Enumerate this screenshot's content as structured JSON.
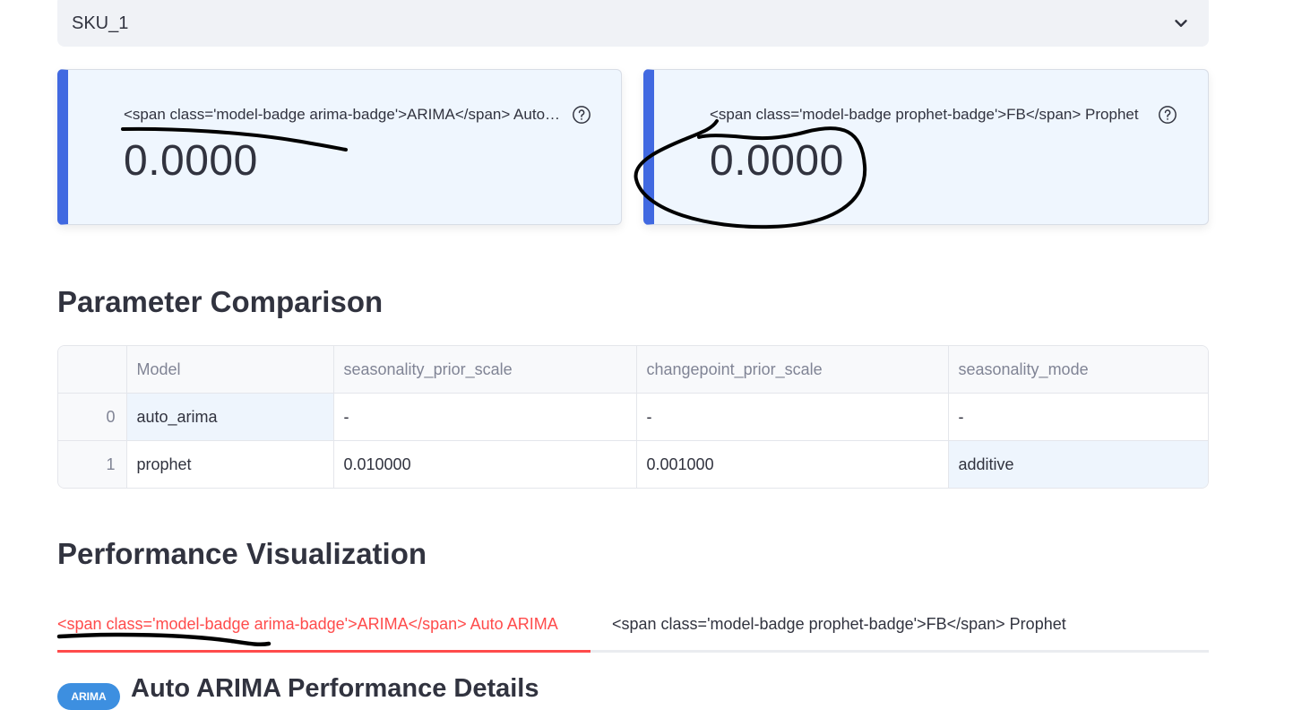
{
  "selectbox": {
    "value": "SKU_1",
    "icon": "chevron-down-icon"
  },
  "metrics": [
    {
      "label": "<span class='model-badge arima-badge'>ARIMA</span> Auto ARIMA",
      "value": "0.0000",
      "accent": "#4169e1"
    },
    {
      "label": "<span class='model-badge prophet-badge'>FB</span> Prophet",
      "value": "0.0000",
      "accent": "#4169e1"
    }
  ],
  "parameter_comparison": {
    "title": "Parameter Comparison",
    "columns": [
      "",
      "Model",
      "seasonality_prior_scale",
      "changepoint_prior_scale",
      "seasonality_mode"
    ],
    "rows": [
      [
        "0",
        "auto_arima",
        "-",
        "-",
        "-"
      ],
      [
        "1",
        "prophet",
        "0.010000",
        "0.001000",
        "additive"
      ]
    ]
  },
  "performance": {
    "title": "Performance Visualization",
    "tabs": [
      {
        "label": "<span class='model-badge arima-badge'>ARIMA</span> Auto ARIMA",
        "active": true
      },
      {
        "label": "<span class='model-badge prophet-badge'>FB</span> Prophet",
        "active": false
      }
    ],
    "active_color": "#ff4b4b",
    "detail_badge": "ARIMA",
    "detail_title": "Auto ARIMA Performance Details"
  }
}
